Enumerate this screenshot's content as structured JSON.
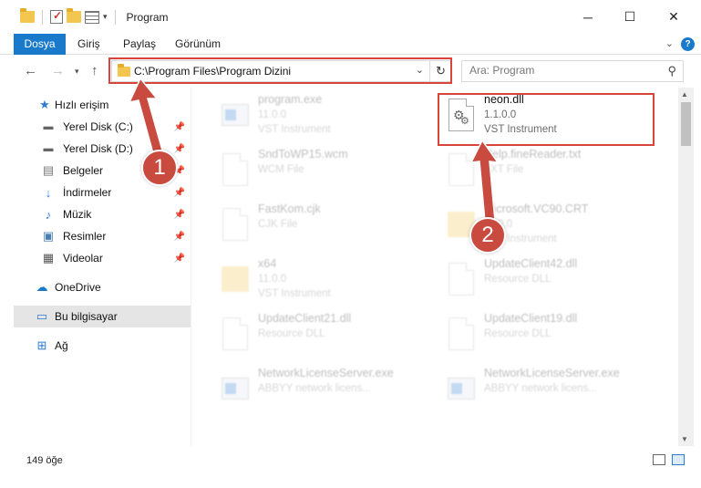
{
  "window": {
    "title": "Program",
    "minimize": "─",
    "maximize": "☐",
    "close": "✕"
  },
  "ribbon": {
    "tabs": [
      "Dosya",
      "Giriş",
      "Paylaş",
      "Görünüm"
    ],
    "help": "?"
  },
  "address": {
    "path": "C:\\Program Files\\Program Dizini",
    "refresh_icon": "refresh-icon"
  },
  "search": {
    "placeholder": "Ara: Program"
  },
  "sidebar": {
    "items": [
      {
        "label": "Hızlı erişim",
        "icon": "star-icon",
        "pinned": false
      },
      {
        "label": "Yerel Disk (C:)",
        "icon": "drive-icon",
        "pinned": true
      },
      {
        "label": "Yerel Disk (D:)",
        "icon": "drive-icon",
        "pinned": true
      },
      {
        "label": "Belgeler",
        "icon": "documents-icon",
        "pinned": true
      },
      {
        "label": "İndirmeler",
        "icon": "download-icon",
        "pinned": true
      },
      {
        "label": "Müzik",
        "icon": "music-icon",
        "pinned": true
      },
      {
        "label": "Resimler",
        "icon": "pictures-icon",
        "pinned": true
      },
      {
        "label": "Videolar",
        "icon": "videos-icon",
        "pinned": true
      },
      {
        "label": "OneDrive",
        "icon": "cloud-icon",
        "pinned": false
      },
      {
        "label": "Bu bilgisayar",
        "icon": "computer-icon",
        "pinned": false
      },
      {
        "label": "Ağ",
        "icon": "network-icon",
        "pinned": false
      }
    ]
  },
  "files": [
    {
      "name": "program.exe",
      "line1": "11.0.0",
      "line2": "VST Instrument",
      "icon": "exe-icon"
    },
    {
      "name": "neon.dll",
      "line1": "1.1.0.0",
      "line2": "VST Instrument",
      "icon": "dll-icon"
    },
    {
      "name": "SndToWP15.wcm",
      "line1": "WCM File",
      "line2": "",
      "icon": "file-icon"
    },
    {
      "name": "Help.fineReader.txt",
      "line1": "TXT File",
      "line2": "",
      "icon": "file-icon"
    },
    {
      "name": "FastKom.cjk",
      "line1": "CJK File",
      "line2": "",
      "icon": "file-icon"
    },
    {
      "name": "Microsoft.VC90.CRT",
      "line1": "11.0.0",
      "line2": "VST Instrument",
      "icon": "folder-icon"
    },
    {
      "name": "x64",
      "line1": "11.0.0",
      "line2": "VST Instrument",
      "icon": "folder-icon"
    },
    {
      "name": "UpdateClient42.dll",
      "line1": "Resource DLL",
      "line2": "",
      "icon": "dll-icon"
    },
    {
      "name": "UpdateClient21.dll",
      "line1": "Resource DLL",
      "line2": "",
      "icon": "dll-icon"
    },
    {
      "name": "UpdateClient19.dll",
      "line1": "Resource DLL",
      "line2": "",
      "icon": "dll-icon"
    },
    {
      "name": "NetworkLicenseServer.exe",
      "line1": "ABBYY network licens...",
      "line2": "",
      "icon": "exe-icon"
    },
    {
      "name": "NetworkLicenseServer.exe",
      "line1": "ABBYY network licens...",
      "line2": "",
      "icon": "exe-icon"
    }
  ],
  "status": {
    "count": "149 öğe"
  },
  "annotations": {
    "badge1": "1",
    "badge2": "2",
    "highlight_color": "#d9443b"
  },
  "colors": {
    "accent": "#1979ca",
    "selected_bg": "#e5e5e5"
  }
}
